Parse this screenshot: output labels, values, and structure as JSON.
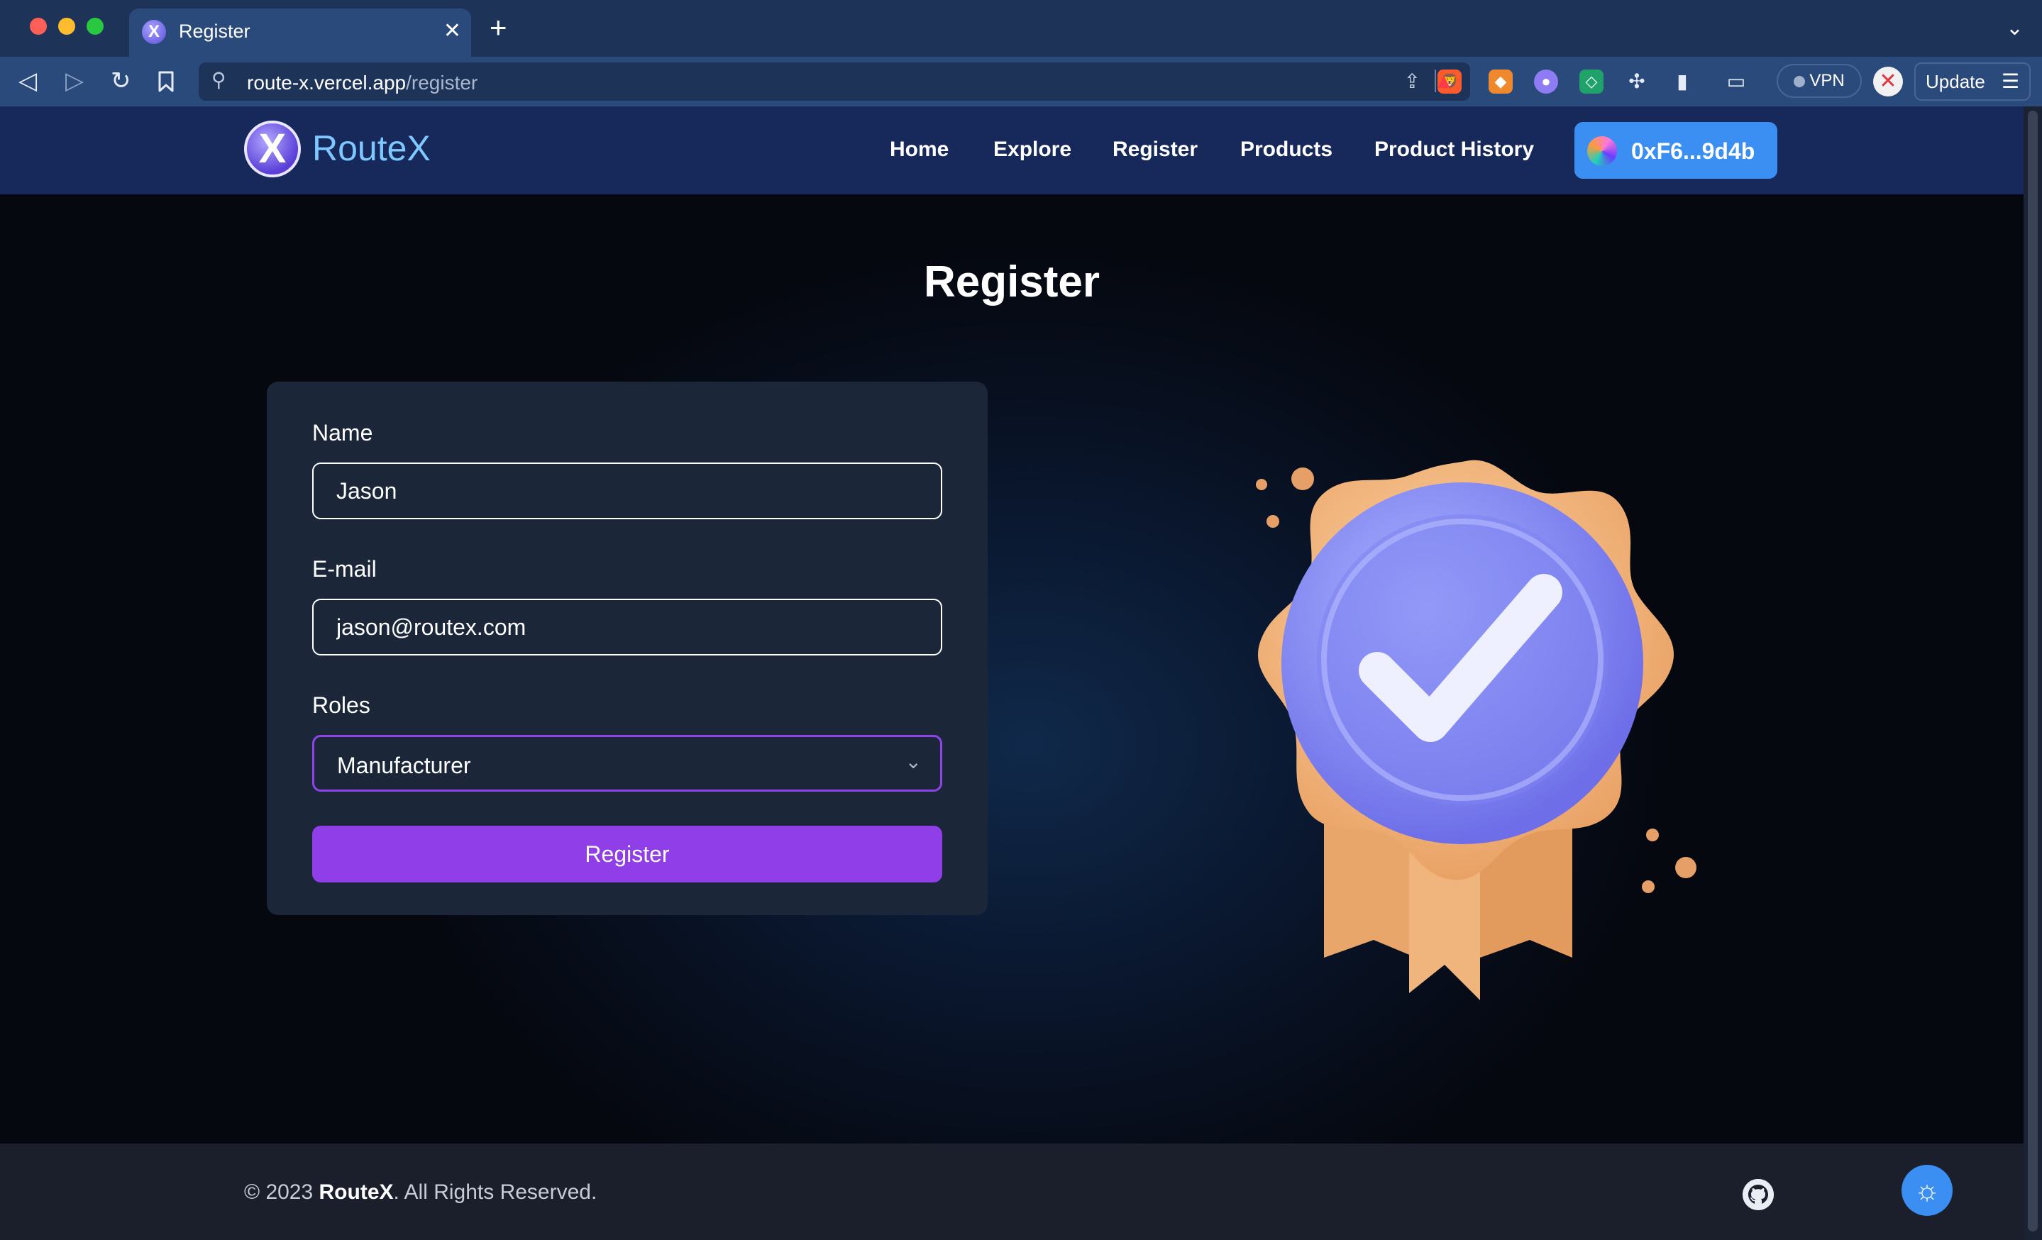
{
  "browser": {
    "tab": {
      "title": "Register",
      "close_glyph": "✕"
    },
    "new_tab_glyph": "+",
    "address": {
      "host": "route-x.vercel.app",
      "path": "/register"
    },
    "vpn_label": "VPN",
    "update_label": "Update"
  },
  "site": {
    "brand": "RouteX",
    "logo_glyph": "X",
    "nav": [
      "Home",
      "Explore",
      "Register",
      "Products",
      "Product History"
    ],
    "wallet": "0xF6...9d4b"
  },
  "page": {
    "title": "Register",
    "form": {
      "name_label": "Name",
      "name_value": "Jason",
      "email_label": "E-mail",
      "email_value": "jason@routex.com",
      "roles_label": "Roles",
      "role_selected": "Manufacturer",
      "submit_label": "Register"
    }
  },
  "footer": {
    "year_prefix": "© 2023 ",
    "brand": "RouteX",
    "rights": ". All Rights Reserved."
  },
  "colors": {
    "header_bg": "#17295a",
    "accent_purple": "#8f3ee8",
    "wallet_blue": "#3b8ef2",
    "brand_text": "#7fc7ff"
  },
  "icons": [
    "search-icon",
    "share-icon",
    "bookmark-icon",
    "reload-icon",
    "github-icon",
    "sun-icon",
    "chevron-down-icon",
    "checkmark-badge-icon"
  ]
}
